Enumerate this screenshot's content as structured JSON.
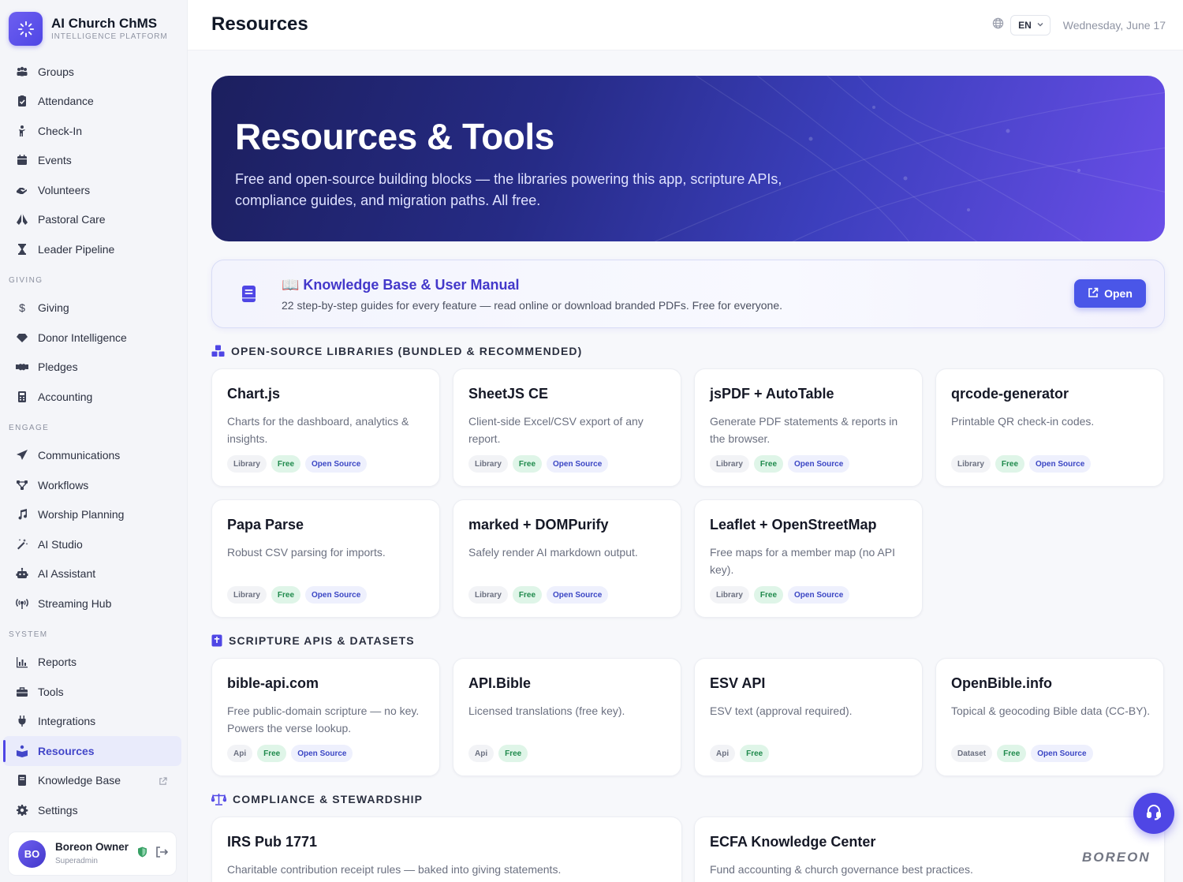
{
  "brand": {
    "name": "AI Church ChMS",
    "subtitle": "INTELLIGENCE PLATFORM"
  },
  "header": {
    "title": "Resources",
    "language": "EN",
    "date": "Wednesday, June 17"
  },
  "sidebar": {
    "items_top": [
      {
        "label": "Groups",
        "icon": "groups-icon"
      },
      {
        "label": "Attendance",
        "icon": "clipboard-check-icon"
      },
      {
        "label": "Check-In",
        "icon": "child-icon"
      },
      {
        "label": "Events",
        "icon": "calendar-icon"
      },
      {
        "label": "Volunteers",
        "icon": "hands-helping-icon"
      },
      {
        "label": "Pastoral Care",
        "icon": "hands-praying-icon"
      },
      {
        "label": "Leader Pipeline",
        "icon": "hourglass-icon"
      }
    ],
    "giving_heading": "GIVING",
    "items_giving": [
      {
        "label": "Giving",
        "icon": "dollar-icon"
      },
      {
        "label": "Donor Intelligence",
        "icon": "gem-icon"
      },
      {
        "label": "Pledges",
        "icon": "handshake-icon"
      },
      {
        "label": "Accounting",
        "icon": "calculator-icon"
      }
    ],
    "engage_heading": "ENGAGE",
    "items_engage": [
      {
        "label": "Communications",
        "icon": "paper-plane-icon"
      },
      {
        "label": "Workflows",
        "icon": "workflow-icon"
      },
      {
        "label": "Worship Planning",
        "icon": "music-icon"
      },
      {
        "label": "AI Studio",
        "icon": "magic-wand-icon"
      },
      {
        "label": "AI Assistant",
        "icon": "robot-icon"
      },
      {
        "label": "Streaming Hub",
        "icon": "broadcast-icon"
      }
    ],
    "system_heading": "SYSTEM",
    "items_system": [
      {
        "label": "Reports",
        "icon": "bar-chart-icon"
      },
      {
        "label": "Tools",
        "icon": "toolbox-icon"
      },
      {
        "label": "Integrations",
        "icon": "plug-icon"
      },
      {
        "label": "Resources",
        "icon": "book-reader-icon"
      },
      {
        "label": "Knowledge Base",
        "icon": "book-icon"
      },
      {
        "label": "Settings",
        "icon": "gear-icon"
      }
    ],
    "active": "Resources"
  },
  "user": {
    "initials": "BO",
    "name": "Boreon Owner",
    "role": "Superadmin"
  },
  "hero": {
    "title": "Resources & Tools",
    "description": "Free and open-source building blocks — the libraries powering this app, scripture APIs, compliance guides, and migration paths. All free."
  },
  "knowledge_base": {
    "title": "📖 Knowledge Base & User Manual",
    "description": "22 step-by-step guides for every feature — read online or download branded PDFs. Free for everyone.",
    "button": "Open"
  },
  "sections": {
    "libraries": {
      "heading": "OPEN-SOURCE LIBRARIES (BUNDLED & RECOMMENDED)",
      "cards": [
        {
          "title": "Chart.js",
          "desc": "Charts for the dashboard, analytics & insights.",
          "tags": [
            "Library",
            "Free",
            "Open Source"
          ]
        },
        {
          "title": "SheetJS CE",
          "desc": "Client-side Excel/CSV export of any report.",
          "tags": [
            "Library",
            "Free",
            "Open Source"
          ]
        },
        {
          "title": "jsPDF + AutoTable",
          "desc": "Generate PDF statements & reports in the browser.",
          "tags": [
            "Library",
            "Free",
            "Open Source"
          ]
        },
        {
          "title": "qrcode-generator",
          "desc": "Printable QR check-in codes.",
          "tags": [
            "Library",
            "Free",
            "Open Source"
          ]
        },
        {
          "title": "Papa Parse",
          "desc": "Robust CSV parsing for imports.",
          "tags": [
            "Library",
            "Free",
            "Open Source"
          ]
        },
        {
          "title": "marked + DOMPurify",
          "desc": "Safely render AI markdown output.",
          "tags": [
            "Library",
            "Free",
            "Open Source"
          ]
        },
        {
          "title": "Leaflet + OpenStreetMap",
          "desc": "Free maps for a member map (no API key).",
          "tags": [
            "Library",
            "Free",
            "Open Source"
          ]
        }
      ]
    },
    "scripture": {
      "heading": "SCRIPTURE APIS & DATASETS",
      "cards": [
        {
          "title": "bible-api.com",
          "desc": "Free public-domain scripture — no key. Powers the verse lookup.",
          "tags": [
            "Api",
            "Free",
            "Open Source"
          ]
        },
        {
          "title": "API.Bible",
          "desc": "Licensed translations (free key).",
          "tags": [
            "Api",
            "Free"
          ]
        },
        {
          "title": "ESV API",
          "desc": "ESV text (approval required).",
          "tags": [
            "Api",
            "Free"
          ]
        },
        {
          "title": "OpenBible.info",
          "desc": "Topical & geocoding Bible data (CC-BY).",
          "tags": [
            "Dataset",
            "Free",
            "Open Source"
          ]
        }
      ]
    },
    "compliance": {
      "heading": "COMPLIANCE & STEWARDSHIP",
      "cards": [
        {
          "title": "IRS Pub 1771",
          "desc": "Charitable contribution receipt rules — baked into giving statements."
        },
        {
          "title": "ECFA Knowledge Center",
          "desc": "Fund accounting & church governance best practices."
        }
      ]
    }
  },
  "watermark": "BOREON",
  "colors": {
    "accent": "#4f46e5",
    "free_tag": "#1f8a4c",
    "open_source_tag": "#3b46c4"
  }
}
